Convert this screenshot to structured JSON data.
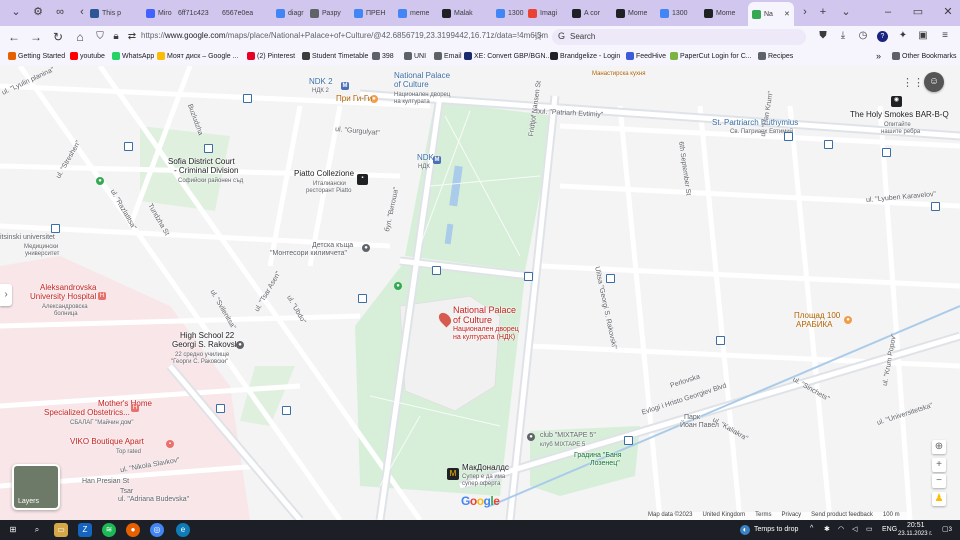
{
  "tabs": [
    {
      "label": "This p",
      "icon": "ms-icon",
      "color": "#2b5797"
    },
    {
      "label": "Miro",
      "icon": "miro-icon",
      "color": "#4262ff"
    },
    {
      "label": "6ff71c423",
      "icon": "",
      "color": ""
    },
    {
      "label": "6567e0ea",
      "icon": "",
      "color": ""
    },
    {
      "label": "diagr",
      "icon": "google-icon",
      "color": "#4285f4"
    },
    {
      "label": "Разру",
      "icon": "chat-icon",
      "color": "#5f6368"
    },
    {
      "label": "ПРЕН",
      "icon": "google-icon",
      "color": "#4285f4"
    },
    {
      "label": "meme",
      "icon": "google-icon",
      "color": "#4285f4"
    },
    {
      "label": "Malak",
      "icon": "ah-icon",
      "color": "#202124"
    },
    {
      "label": "1300",
      "icon": "google-icon",
      "color": "#4285f4"
    },
    {
      "label": "Imagi",
      "icon": "image-icon",
      "color": "#ea4335"
    },
    {
      "label": "A cor",
      "icon": "gear-icon",
      "color": "#202124"
    },
    {
      "label": "Mome",
      "icon": "notion-icon",
      "color": "#202124"
    },
    {
      "label": "1300",
      "icon": "google-icon",
      "color": "#4285f4"
    },
    {
      "label": "Mome",
      "icon": "notion-icon",
      "color": "#202124"
    },
    {
      "label": "Na",
      "icon": "maps-icon",
      "color": "#34a853"
    }
  ],
  "address": {
    "url_prefix": "https://",
    "url_domain": "www.google.com",
    "url_path": "/maps/place/National+Palace+of+Culture/@42.6856719,23.3199442,16.71z/data=!4m6!3m",
    "search_placeholder": "Search"
  },
  "bookmarks": [
    {
      "label": "Getting Started",
      "icon": "firefox-icon",
      "color": "#e66000"
    },
    {
      "label": "youtube",
      "icon": "youtube-icon",
      "color": "#ff0000"
    },
    {
      "label": "WhatsApp",
      "icon": "whatsapp-icon",
      "color": "#25d366"
    },
    {
      "label": "Моят диск – Google ...",
      "icon": "drive-icon",
      "color": "#fbbc04"
    },
    {
      "label": "(2) Pinterest",
      "icon": "pinterest-icon",
      "color": "#e60023"
    },
    {
      "label": "Student Timetable",
      "icon": "calendar-icon",
      "color": "#3c3c3c"
    },
    {
      "label": "398",
      "icon": "folder-icon",
      "color": "#5f6368"
    },
    {
      "label": "UNI",
      "icon": "folder-icon",
      "color": "#5f6368"
    },
    {
      "label": "Email",
      "icon": "folder-icon",
      "color": "#5f6368"
    },
    {
      "label": "XE: Convert GBP/BGN...",
      "icon": "xe-icon",
      "color": "#1a2b6d"
    },
    {
      "label": "Brandgelize - Login",
      "icon": "brand-icon",
      "color": "#202124"
    },
    {
      "label": "FeedHive",
      "icon": "feedhive-icon",
      "color": "#3b5bdb"
    },
    {
      "label": "PaperCut Login for C...",
      "icon": "papercut-icon",
      "color": "#7cb342"
    },
    {
      "label": "Recipes",
      "icon": "folder-icon",
      "color": "#5f6368"
    },
    {
      "label": "Other Bookmarks",
      "icon": "folder-icon",
      "color": "#5f6368"
    }
  ],
  "map": {
    "labels": {
      "ndk2": "NDK 2",
      "ndk2_bg": "НДК 2",
      "npc_top": "National Palace",
      "npc_top2": "of Culture",
      "npc_top_bg": "Национален дворец",
      "npc_top_bg2": "на културата",
      "pri_gigi": "При Ги-Ги",
      "manastirska": "Манастирска кухня",
      "patriarh": "bul. \"Patriarh Evtimiy\"",
      "gurgulyat": "ul. \"Gurgulyat\"",
      "buzludzha": "Buzludzha",
      "st_patriarch": "St. Partriarch Euthymius",
      "st_patriarch_bg": "Св. Патриарх Евтимий",
      "holy_smokes": "The Holy Smokes BAR-B-Q",
      "holy_smokes_bg1": "Опитайте",
      "holy_smokes_bg2": "нашите ребра",
      "lyulin": "ul. \"Lyulin planina\"",
      "sofia_court": "Sofia District Court",
      "sofia_court2": "- Criminal Division",
      "sofia_court_bg": "Софийски районен съд",
      "piatto": "Piatto Collezione",
      "piatto_bg": "Италиански",
      "piatto_bg2": "ресторант Piatto",
      "ndk": "NDK",
      "ndk_bg": "НДК",
      "frid": "Fridtjof Nansen St",
      "sixth_sept": "6th September St",
      "han_krum": "ul. \"Han Krum\"",
      "lyuben": "ul. \"Lyuben Karavelov\"",
      "streshen": "ul. \"Streshen\"",
      "razlatitsa": "ul. \"Razlatitsa\"",
      "tundzha": "Tundzha St",
      "vitosha": "бул. \"Витоша\"",
      "detska": "Детска къща",
      "detska2": "\"Монтесори килимчета\"",
      "medical": "itsinski universitet",
      "medical_bg": "Медицински",
      "medical_bg2": "университет",
      "aleksandrovska": "Aleksandrovska",
      "aleksandrovska2": "University Hospital",
      "aleksandrovska_bg": "Александровска",
      "aleksandrovska_bg2": "болница",
      "svilenitsa": "ul. \"Svilenitsa\"",
      "tsar_asen": "ul. \"Tsar Asen\"",
      "ubdo": "ul. \"Ubdo\"",
      "npc_main": "National Palace",
      "npc_main2": "of Culture",
      "npc_main_bg": "Национален дворец",
      "npc_main_bg2": "на културата (НДК)",
      "georgi_rakovski": "Ulitsa \"Georgi S. Rakovski\"",
      "ploshtad": "Площад 100",
      "arabika": "АРАБИКА",
      "high_school": "High School 22",
      "high_school2": "Georgi S. Rakovski",
      "high_school_bg": "22 средно училище",
      "high_school_bg2": "\"Георги С. Раковски\"",
      "perlovska": "Perlovska",
      "evlogi": "Evlogi i Hristo Georgiev Blvd",
      "papa": "Парк",
      "papa2": "Йоан Павел",
      "sinchets": "ul. \"Sinchets\"",
      "krum_popov": "ul. \"Krum Popov\"",
      "universitetska": "ul. \"Universitetska\"",
      "kaliakra": "ul. \"Kaliakra\"",
      "mothers_home": "Mother's Home",
      "mothers_home2": "Specialized Obstetrics...",
      "mothers_home_bg": "СБАЛАГ \"Майчин дом\"",
      "viko": "VIKO Boutique Apart",
      "viko_sub": "Top rated",
      "club": "club \"MIXTAPE 5\"",
      "club_bg": "клуб MIXTAPE 5",
      "gradina": "Градина \"Баня",
      "gradina2": "Лозенец\"",
      "mcd": "МакДоналдс",
      "mcd_bg": "Супер е да има",
      "mcd_bg2": "супер оферта",
      "nikola": "ul. \"Nikola Slavkov\"",
      "han_presian": "Han Presian St",
      "adriana": "ul. \"Adriana Budevska\"",
      "tsar": "Tsar",
      "layers": "Layers"
    },
    "attribution": [
      "Map data ©2023",
      "United Kingdom",
      "Terms",
      "Privacy",
      "Send product feedback",
      "100 m"
    ],
    "google_logo": "Google"
  },
  "taskbar": {
    "weather": "Temps to drop",
    "lang": "ENG",
    "time": "20:51",
    "date": "23.11.2023 г.",
    "notif_count": "3"
  }
}
